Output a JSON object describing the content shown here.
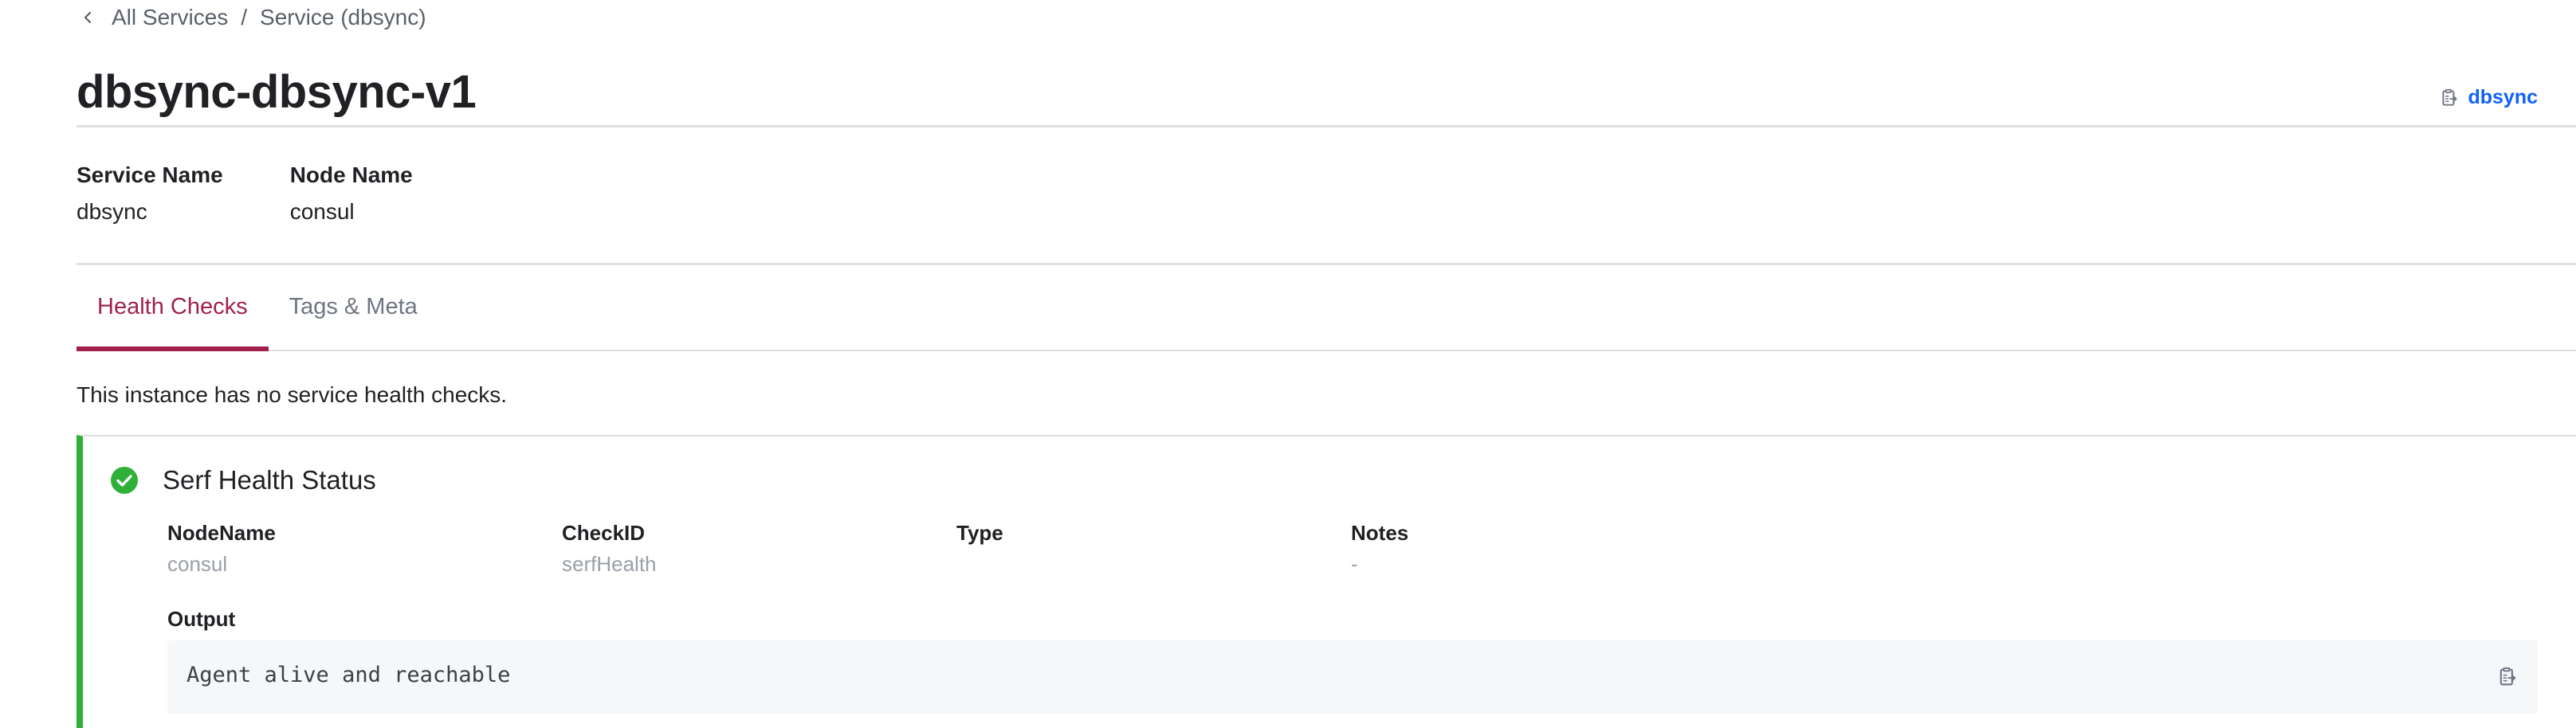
{
  "breadcrumb": {
    "items": [
      "All Services",
      "Service (dbsync)"
    ],
    "separator": "/"
  },
  "header": {
    "title": "dbsync-dbsync-v1",
    "copy_link_label": "dbsync",
    "copy_icon": "clipboard-icon"
  },
  "details": {
    "service_name_label": "Service Name",
    "service_name_value": "dbsync",
    "node_name_label": "Node Name",
    "node_name_value": "consul"
  },
  "tabs": [
    {
      "label": "Health Checks",
      "active": true
    },
    {
      "label": "Tags & Meta",
      "active": false
    }
  ],
  "health": {
    "no_service_checks_message": "This instance has no service health checks.",
    "check": {
      "status": "passing",
      "status_color": "#2eb039",
      "title": "Serf Health Status",
      "fields": [
        {
          "label": "NodeName",
          "value": "consul"
        },
        {
          "label": "CheckID",
          "value": "serfHealth"
        },
        {
          "label": "Type",
          "value": ""
        },
        {
          "label": "Notes",
          "value": "-"
        }
      ],
      "output_label": "Output",
      "output_value": "Agent alive and reachable"
    }
  },
  "colors": {
    "accent": "#a0224a",
    "link": "#1060ff",
    "passing": "#2eb039"
  }
}
